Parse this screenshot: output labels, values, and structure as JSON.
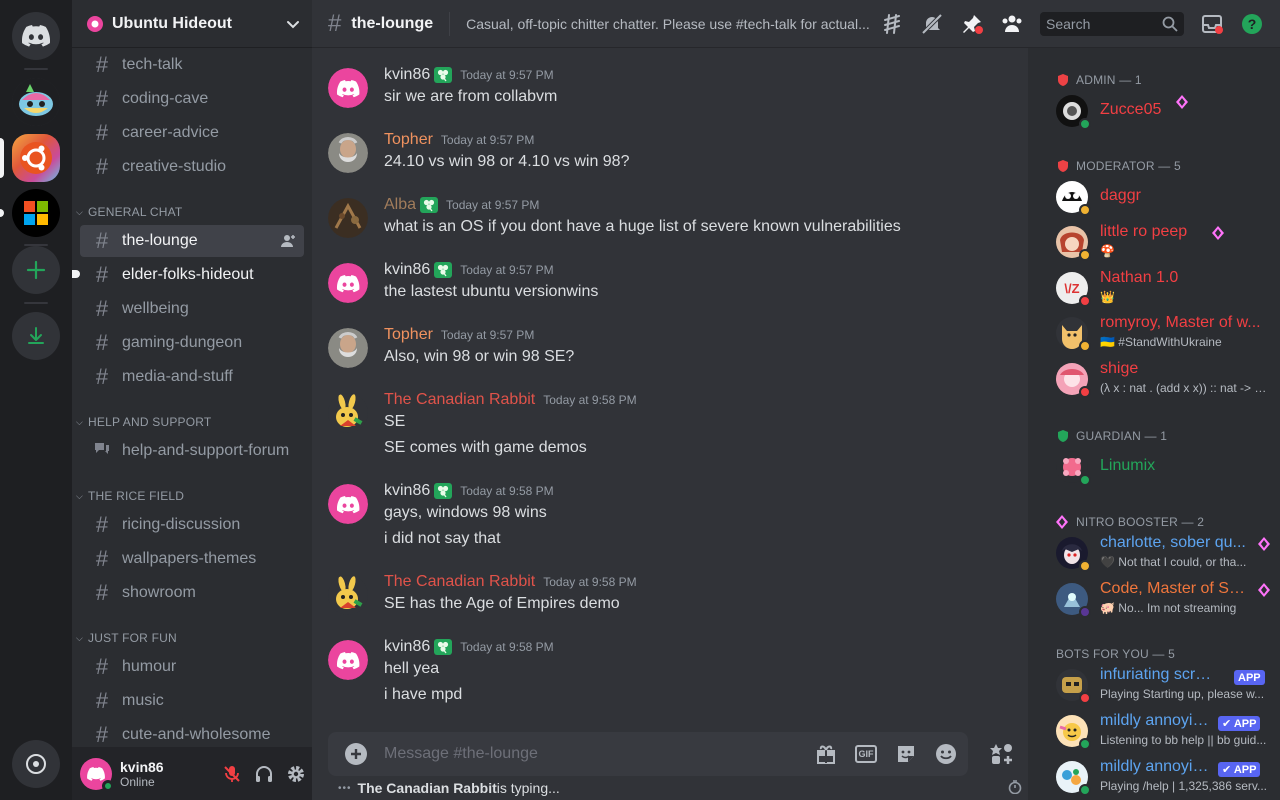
{
  "guild": {
    "name": "Ubuntu Hideout"
  },
  "sidebar": {
    "channels_top": [
      "tech-talk",
      "coding-cave",
      "career-advice",
      "creative-studio"
    ],
    "categories": [
      {
        "label": "GENERAL CHAT"
      },
      {
        "label": "HELP AND SUPPORT"
      },
      {
        "label": "THE RICE FIELD"
      },
      {
        "label": "JUST FOR FUN"
      }
    ],
    "general": [
      "the-lounge",
      "elder-folks-hideout",
      "wellbeing",
      "gaming-dungeon",
      "media-and-stuff"
    ],
    "help": [
      "help-and-support-forum"
    ],
    "rice": [
      "ricing-discussion",
      "wallpapers-themes",
      "showroom"
    ],
    "fun": [
      "humour",
      "music",
      "cute-and-wholesome"
    ]
  },
  "user": {
    "name": "kvin86",
    "status": "Online"
  },
  "header": {
    "hash": "#",
    "channel": "the-lounge",
    "topic": "Casual, off-topic chitter chatter. Please use #tech-talk for actual..."
  },
  "search": {
    "placeholder": "Search"
  },
  "messages": [
    {
      "author": "kvin86",
      "color": "#dbdee1",
      "time": "Today at 9:57 PM",
      "lines": [
        "sir we are from collabvm"
      ],
      "avatar": "discord-pink",
      "badge": true
    },
    {
      "author": "Topher",
      "color": "#f0925f",
      "time": "Today at 9:57 PM",
      "lines": [
        "24.10 vs win 98 or 4.10 vs win 98?"
      ],
      "avatar": "topher",
      "badge": false
    },
    {
      "author": "Alba",
      "color": "#a17c5b",
      "time": "Today at 9:57 PM",
      "lines": [
        "what is an OS if you dont have a huge list of severe known vulnerabilities"
      ],
      "avatar": "alba",
      "badge": true
    },
    {
      "author": "kvin86",
      "color": "#dbdee1",
      "time": "Today at 9:57 PM",
      "lines": [
        "the lastest ubuntu versionwins"
      ],
      "avatar": "discord-pink",
      "badge": true
    },
    {
      "author": "Topher",
      "color": "#f0925f",
      "time": "Today at 9:57 PM",
      "lines": [
        "Also, win 98 or win 98 SE?"
      ],
      "avatar": "topher",
      "badge": false
    },
    {
      "author": "The Canadian Rabbit",
      "color": "#e0534a",
      "time": "Today at 9:58 PM",
      "lines": [
        "SE",
        "SE comes with game demos"
      ],
      "avatar": "rabbit",
      "badge": false
    },
    {
      "author": "kvin86",
      "color": "#dbdee1",
      "time": "Today at 9:58 PM",
      "lines": [
        "gays, windows 98 wins",
        "i did not say that"
      ],
      "avatar": "discord-pink",
      "badge": true
    },
    {
      "author": "The Canadian Rabbit",
      "color": "#e0534a",
      "time": "Today at 9:58 PM",
      "lines": [
        "SE has the Age of Empires demo"
      ],
      "avatar": "rabbit",
      "badge": false
    },
    {
      "author": "kvin86",
      "color": "#dbdee1",
      "time": "Today at 9:58 PM",
      "lines": [
        "hell yea",
        "i have mpd"
      ],
      "avatar": "discord-pink",
      "badge": true
    }
  ],
  "composer": {
    "placeholder": "Message #the-lounge",
    "gif_label": "GIF"
  },
  "typing": {
    "dots": "•••",
    "who": "The Canadian Rabbit",
    "suffix": " is typing..."
  },
  "members": {
    "roles": [
      {
        "label": "ADMIN — 1",
        "color": "#ed4245"
      },
      {
        "label": "MODERATOR — 5",
        "color": "#ed4245"
      },
      {
        "label": "GUARDIAN — 1",
        "color": "#23a55a"
      },
      {
        "label": "NITRO BOOSTER — 2",
        "color": "#ff73fa"
      },
      {
        "label": "BOTS FOR YOU — 5",
        "color": "#949ba4"
      }
    ],
    "list": [
      {
        "name": "Zucce05",
        "color": "#f23f43",
        "sub": ""
      },
      {
        "name": "daggr",
        "color": "#f23f43",
        "sub": ""
      },
      {
        "name": "little ro peep",
        "color": "#f23f43",
        "sub": "🍄"
      },
      {
        "name": "Nathan 1.0",
        "color": "#f23f43",
        "sub": "👑"
      },
      {
        "name": "romyroy, Master of w...",
        "color": "#f23f43",
        "sub": "🇺🇦 #StandWithUkraine"
      },
      {
        "name": "shige",
        "color": "#f23f43",
        "sub": "(λ x : nat . (add x x)) :: nat -> nat"
      },
      {
        "name": "Linumix",
        "color": "#23a55a",
        "sub": ""
      },
      {
        "name": "charlotte, sober qu...",
        "color": "#5da4f0",
        "sub": "🖤 Not that I could, or tha..."
      },
      {
        "name": "Code, Master of Sn...",
        "color": "#f0763c",
        "sub": "🐖 No... Im not streaming"
      },
      {
        "name": "infuriating scrap ...",
        "color": "#5da4f0",
        "sub": "Playing Starting up, please w..."
      },
      {
        "name": "mildly annoyin...",
        "color": "#5da4f0",
        "sub": "Listening to bb help || bb guid..."
      },
      {
        "name": "mildly annoyin...",
        "color": "#5da4f0",
        "sub": "Playing /help | 1,325,386 serv..."
      }
    ],
    "app_label": "APP",
    "app_label_check": "✔ APP"
  },
  "colors": {
    "bg_chat": "#313338",
    "bg_sidebar": "#2b2d31",
    "bg_rail": "#1e1f22",
    "accent": "#5865f2",
    "online": "#23a55a",
    "dnd": "#f23f43",
    "idle": "#f0b232"
  }
}
